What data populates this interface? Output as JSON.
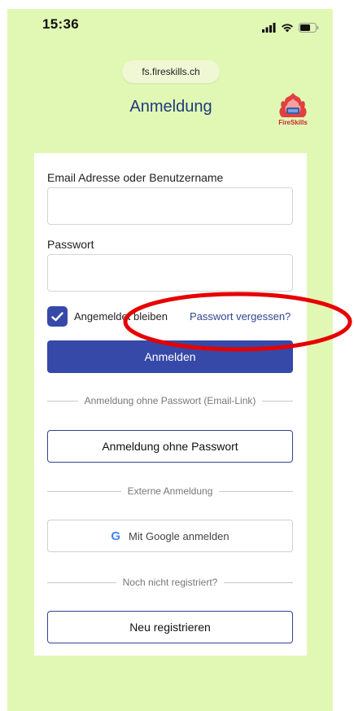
{
  "status_bar": {
    "time": "15:36"
  },
  "browser": {
    "url": "fs.fireskills.ch"
  },
  "header": {
    "title": "Anmeldung",
    "logo_text": "FireSkills"
  },
  "form": {
    "username_label": "Email Adresse oder Benutzername",
    "username_value": "",
    "password_label": "Passwort",
    "password_value": "",
    "remember_label": "Angemeldet bleiben",
    "remember_checked": true,
    "forgot_link": "Passwort vergessen?",
    "login_button": "Anmelden"
  },
  "passwordless": {
    "divider": "Anmeldung ohne Passwort (Email-Link)",
    "button": "Anmeldung ohne Passwort"
  },
  "external": {
    "divider": "Externe Anmeldung",
    "google_button": "Mit Google anmelden",
    "google_icon_letter": "G"
  },
  "register": {
    "divider": "Noch nicht registriert?",
    "button": "Neu registrieren"
  },
  "colors": {
    "background": "#e1f8b5",
    "primary": "#3649a8",
    "link": "#2f468f",
    "annotation": "#e60000"
  },
  "icons": [
    "signal-icon",
    "wifi-icon",
    "battery-icon",
    "checkmark-icon",
    "google-icon",
    "fireskills-logo"
  ]
}
